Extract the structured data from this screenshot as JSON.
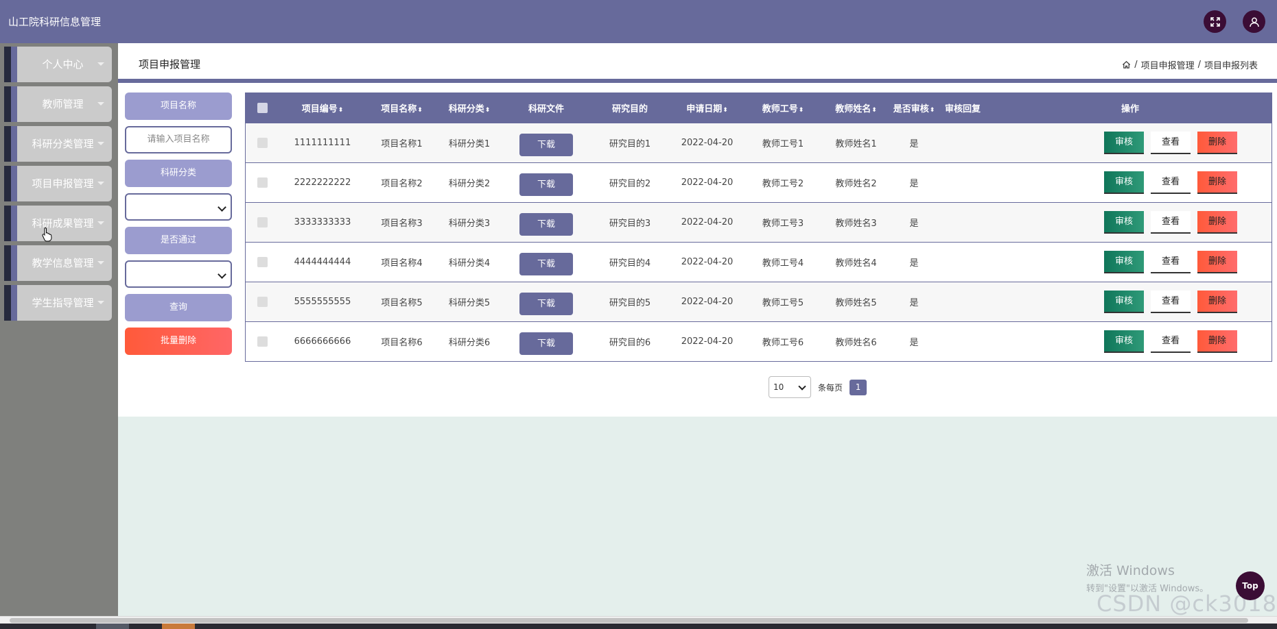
{
  "header": {
    "title": "山工院科研信息管理",
    "icons": [
      "fullscreen-icon",
      "user-icon"
    ]
  },
  "sidebar": {
    "items": [
      {
        "label": "个人中心"
      },
      {
        "label": "教师管理"
      },
      {
        "label": "科研分类管理"
      },
      {
        "label": "项目申报管理"
      },
      {
        "label": "科研成果管理"
      },
      {
        "label": "教学信息管理"
      },
      {
        "label": "学生指导管理"
      }
    ]
  },
  "page": {
    "title": "项目申报管理",
    "breadcrumb": [
      "项目申报管理",
      "项目申报列表"
    ]
  },
  "filter": {
    "name_label": "项目名称",
    "name_placeholder": "请输入项目名称",
    "category_label": "科研分类",
    "category_value": "",
    "passed_label": "是否通过",
    "passed_value": "",
    "search_button": "查询",
    "batch_delete_button": "批量删除"
  },
  "table": {
    "headers": [
      "项目编号",
      "项目名称",
      "科研分类",
      "科研文件",
      "研究目的",
      "申请日期",
      "教师工号",
      "教师姓名",
      "是否审核",
      "审核回复",
      "操作"
    ],
    "sort_symbol": "⬍",
    "download_label": "下载",
    "actions": {
      "audit": "审核",
      "view": "查看",
      "delete": "删除"
    },
    "rows": [
      {
        "id": "1111111111",
        "name": "项目名称1",
        "category": "科研分类1",
        "purpose": "研究目的1",
        "date": "2022-04-20",
        "teacher_no": "教师工号1",
        "teacher_name": "教师姓名1",
        "audited": "是",
        "reply": ""
      },
      {
        "id": "2222222222",
        "name": "项目名称2",
        "category": "科研分类2",
        "purpose": "研究目的2",
        "date": "2022-04-20",
        "teacher_no": "教师工号2",
        "teacher_name": "教师姓名2",
        "audited": "是",
        "reply": ""
      },
      {
        "id": "3333333333",
        "name": "项目名称3",
        "category": "科研分类3",
        "purpose": "研究目的3",
        "date": "2022-04-20",
        "teacher_no": "教师工号3",
        "teacher_name": "教师姓名3",
        "audited": "是",
        "reply": ""
      },
      {
        "id": "4444444444",
        "name": "项目名称4",
        "category": "科研分类4",
        "purpose": "研究目的4",
        "date": "2022-04-20",
        "teacher_no": "教师工号4",
        "teacher_name": "教师姓名4",
        "audited": "是",
        "reply": ""
      },
      {
        "id": "5555555555",
        "name": "项目名称5",
        "category": "科研分类5",
        "purpose": "研究目的5",
        "date": "2022-04-20",
        "teacher_no": "教师工号5",
        "teacher_name": "教师姓名5",
        "audited": "是",
        "reply": ""
      },
      {
        "id": "6666666666",
        "name": "项目名称6",
        "category": "科研分类6",
        "purpose": "研究目的6",
        "date": "2022-04-20",
        "teacher_no": "教师工号6",
        "teacher_name": "教师姓名6",
        "audited": "是",
        "reply": ""
      }
    ]
  },
  "pagination": {
    "page_size": "10",
    "per_page_label": "条每页",
    "current_page": "1"
  },
  "overlays": {
    "activation_title": "激活 Windows",
    "activation_sub": "转到\"设置\"以激活 Windows。",
    "csdn_watermark": "CSDN @ck3018",
    "top_button": "Top"
  },
  "colors": {
    "primary": "#676a9b",
    "dark_accent": "#3b0d35",
    "light_pill": "#9b9ccf",
    "audit_green": "#10765a",
    "danger_red": "#ff5a3a",
    "page_bg": "#e4efec",
    "sidebar_bg": "#7f807d"
  }
}
